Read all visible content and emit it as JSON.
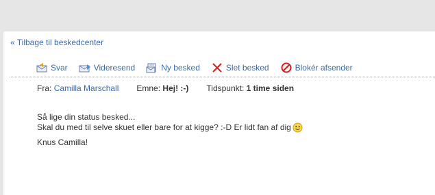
{
  "nav": {
    "back_label": "« Tilbage til beskedcenter"
  },
  "toolbar": {
    "reply_label": "Svar",
    "forward_label": "Videresend",
    "new_label": "Ny besked",
    "delete_label": "Slet besked",
    "block_label": "Blokér afsender"
  },
  "message": {
    "from_label": "Fra:",
    "from_name": "Camilla Marschall",
    "subject_label": "Emne:",
    "subject": "Hej! :-)",
    "time_label": "Tidspunkt:",
    "time_value": "1 time siden",
    "body_line1": "Så lige din status besked...",
    "body_line2": "Skal du med til selve skuet eller bare for at kigge? :-D Er lidt fan af dig",
    "signature": "Knus Camilla!"
  },
  "icons": {
    "reply": "reply-envelope-icon",
    "forward": "forward-envelope-icon",
    "new": "new-message-icon",
    "delete": "delete-x-icon",
    "block": "block-icon",
    "smiley": "smiley-icon"
  },
  "colors": {
    "link": "#3c6aa8",
    "delete_x": "#d02020",
    "block_red": "#cc2222",
    "background": "#e6e6e6",
    "panel": "#ffffff"
  }
}
